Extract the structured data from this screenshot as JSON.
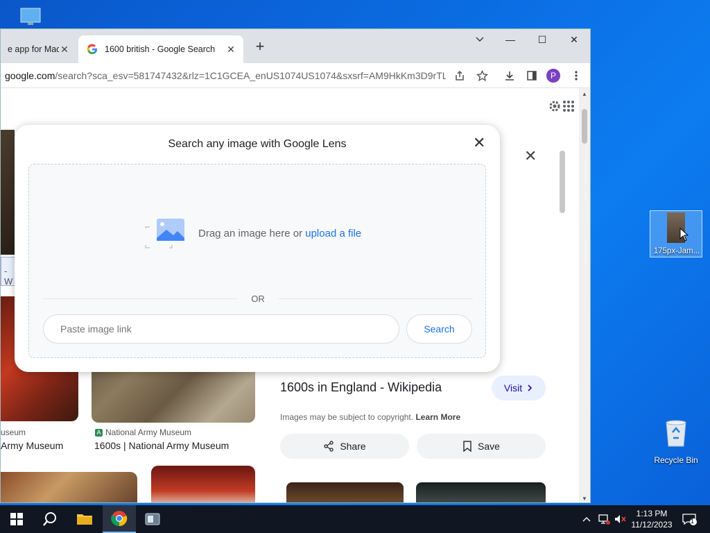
{
  "browser": {
    "tabs": [
      {
        "title": "e app for Mac",
        "active": false
      },
      {
        "title": "1600 british - Google Search",
        "active": true
      }
    ],
    "url_host": "google.com",
    "url_path": "/search?sca_esv=581747432&rlz=1C1GCEA_enUS1074US1074&sxsrf=AM9HkKm3D9rTL6...",
    "profile_initial": "P",
    "accent": "#7b3fc1"
  },
  "lens_dialog": {
    "title": "Search any image with Google Lens",
    "drag_text": "Drag an image here or ",
    "upload_link": "upload a file",
    "or_label": "OR",
    "link_placeholder": "Paste image link",
    "search_button": "Search"
  },
  "results": {
    "left_label": "- W",
    "left_source": "useum",
    "left_title": "Army Museum",
    "mid_source": "National Army Museum",
    "mid_badge": "A",
    "mid_title": "1600s | National Army Museum"
  },
  "side_panel": {
    "title": "1600s in England - Wikipedia",
    "visit": "Visit",
    "copyright": "Images may be subject to copyright.",
    "learn_more": "Learn More",
    "share": "Share",
    "save": "Save"
  },
  "desktop": {
    "file_label": "175px-Jam...",
    "recycle_label": "Recycle Bin"
  },
  "taskbar": {
    "time": "1:13 PM",
    "date": "11/12/2023",
    "notification_count": "1"
  }
}
